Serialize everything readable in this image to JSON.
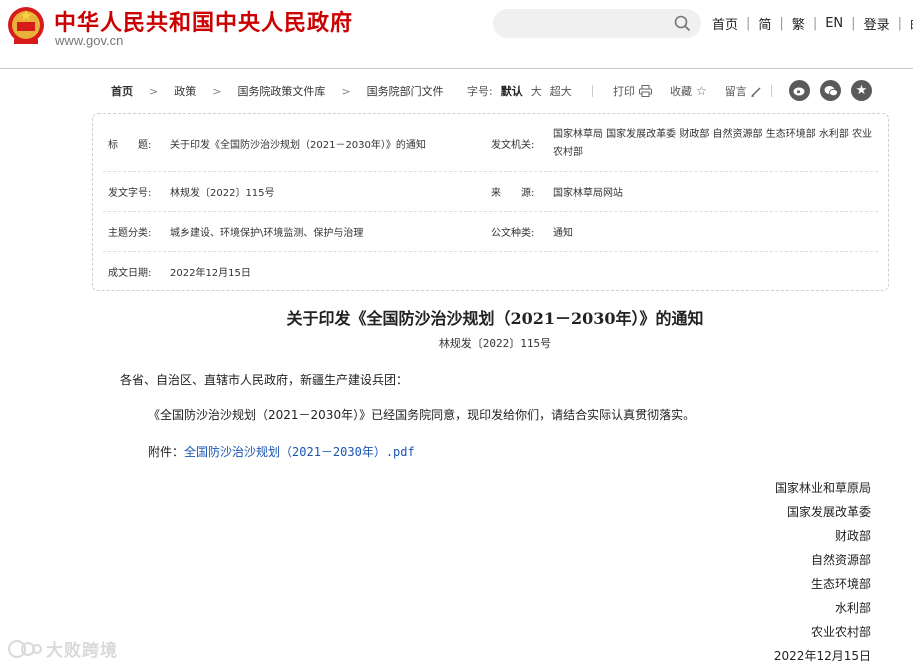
{
  "header": {
    "site_title": "中华人民共和国中央人民政府",
    "site_url": "www.gov.cn",
    "search": {
      "placeholder": ""
    },
    "nav": [
      "首页",
      "简",
      "繁",
      "EN",
      "登录",
      "邮箱"
    ]
  },
  "breadcrumb": {
    "items": [
      "首页",
      "政策",
      "国务院政策文件库",
      "国务院部门文件"
    ]
  },
  "toolbar": {
    "font_size_label": "字号:",
    "font_sizes": [
      "默认",
      "大",
      "超大"
    ],
    "font_size_selected": "默认",
    "print": "打印",
    "favorite": "收藏",
    "comment": "留言"
  },
  "meta": {
    "title_label": "标　　题:",
    "title_value": "关于印发《全国防沙治沙规划（2021－2030年）》的通知",
    "issuer_label": "发文机关:",
    "issuer_value": "国家林草局 国家发展改革委 财政部 自然资源部 生态环境部 水利部 农业农村部",
    "docno_label": "发文字号:",
    "docno_value": "林规发〔2022〕115号",
    "source_label": "来　　源:",
    "source_value": "国家林草局网站",
    "topic_label": "主题分类:",
    "topic_value": "城乡建设、环境保护\\环境监测、保护与治理",
    "type_label": "公文种类:",
    "type_value": "通知",
    "date_label": "成文日期:",
    "date_value": "2022年12月15日"
  },
  "article": {
    "title": "关于印发《全国防沙治沙规划（2021－2030年）》的通知",
    "doc_no": "林规发〔2022〕115号",
    "salutation": "各省、自治区、直辖市人民政府，新疆生产建设兵团：",
    "body": "《全国防沙治沙规划（2021－2030年）》已经国务院同意，现印发给你们，请结合实际认真贯彻落实。",
    "attachment_label": "附件：",
    "attachment_link": "全国防沙治沙规划（2021－2030年）.pdf",
    "signatories": [
      "国家林业和草原局",
      "国家发展改革委",
      "财政部",
      "自然资源部",
      "生态环境部",
      "水利部",
      "农业农村部"
    ],
    "sign_date": "2022年12月15日"
  },
  "watermark": {
    "text": "大败跨境"
  },
  "colors": {
    "brand_red": "#cc0000",
    "link_blue": "#1a55b5"
  }
}
